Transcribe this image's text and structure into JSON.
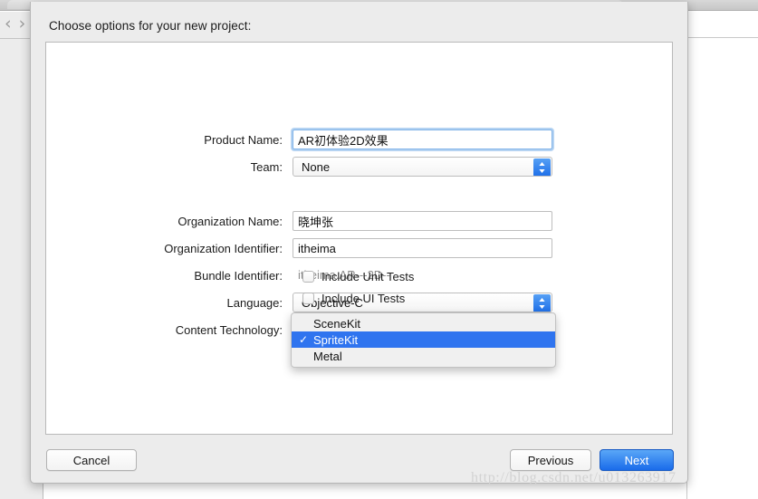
{
  "background_window": {
    "nav_back_icon": "chevron-left-icon",
    "nav_forward_icon": "chevron-right-icon"
  },
  "dialog": {
    "title": "Choose options for your new project:",
    "fields": [
      {
        "label": "Product Name:",
        "type": "text",
        "value": "AR初体验2D效果",
        "placeholder": "",
        "focused": true
      },
      {
        "label": "Team:",
        "type": "popup",
        "value": "None"
      },
      {
        "label": "Organization Name:",
        "type": "text",
        "value": "晓坤张",
        "placeholder": "",
        "focused": false
      },
      {
        "label": "Organization Identifier:",
        "type": "text",
        "value": "itheima",
        "placeholder": "",
        "focused": false
      },
      {
        "label": "Bundle Identifier:",
        "type": "static",
        "value": "itheima.AR---2D--"
      },
      {
        "label": "Language:",
        "type": "popup",
        "value": "Objective-C"
      },
      {
        "label": "Content Technology:",
        "type": "popup",
        "value": ""
      }
    ],
    "checkboxes": [
      {
        "label": "Include Unit Tests",
        "checked": false
      },
      {
        "label": "Include UI Tests",
        "checked": false
      }
    ],
    "dropdown": {
      "open": true,
      "belongs_to": "Content Technology:",
      "options": [
        {
          "label": "SceneKit",
          "selected": false
        },
        {
          "label": "SpriteKit",
          "selected": true
        },
        {
          "label": "Metal",
          "selected": false
        }
      ],
      "check_glyph": "✓",
      "highlight_color": "#2f74ef"
    },
    "buttons": {
      "cancel": "Cancel",
      "previous": "Previous",
      "next": "Next",
      "next_color": "#1a6bea"
    }
  },
  "watermark": {
    "text": "http://blog.csdn.net/u013263917"
  }
}
